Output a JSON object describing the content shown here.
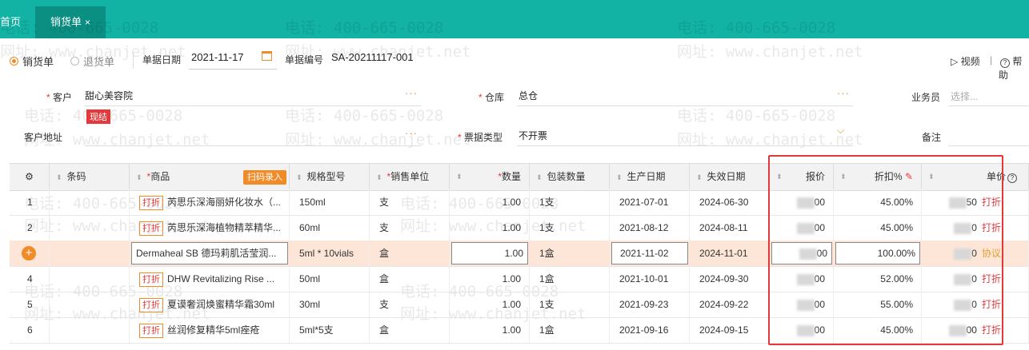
{
  "tabs": [
    {
      "label": "首页"
    },
    {
      "label": "销货单"
    }
  ],
  "close_glyph": "×",
  "doc_type": {
    "options": [
      "销货单",
      "退货单"
    ],
    "selected": "销货单"
  },
  "header": {
    "date_label": "单据日期",
    "date_value": "2021-11-17",
    "no_label": "单据编号",
    "no_value": "SA-20211117-001",
    "video_label": "视频",
    "help_label": "帮助",
    "divider": "|"
  },
  "form": {
    "customer_label": "客户",
    "customer_value": "甜心美容院",
    "customer_badge": "现结",
    "address_label": "客户地址",
    "warehouse_label": "仓库",
    "warehouse_value": "总仓",
    "invoice_label": "票据类型",
    "invoice_value": "不开票",
    "salesman_label": "业务员",
    "salesman_placeholder": "选择...",
    "remark_label": "备注",
    "more": "···",
    "required_mark": "*"
  },
  "watermark": {
    "phone": "电话: 400-665-0028",
    "site": "网址: www.chanjet.net"
  },
  "table": {
    "columns": {
      "barcode": "条码",
      "product": "商品",
      "scan": "扫码录入",
      "spec": "规格型号",
      "unit": "销售单位",
      "qty": "数量",
      "pack": "包装数量",
      "mfg": "生产日期",
      "exp": "失效日期",
      "price": "报价",
      "discount": "折扣%",
      "unit_price": "单价"
    },
    "rows": [
      {
        "no": "1",
        "tag": "打折",
        "product": "芮思乐深海丽妍化妆水（...",
        "spec": "150ml",
        "unit": "支",
        "qty": "1.00",
        "pack": "1支",
        "mfg": "2021-07-01",
        "exp": "2024-06-30",
        "price": "00",
        "discount": "45.00%",
        "unit_price": "50",
        "action": "打折"
      },
      {
        "no": "2",
        "tag": "打折",
        "product": "芮思乐深海植物精萃精华...",
        "spec": "60ml",
        "unit": "支",
        "qty": "1.00",
        "pack": "1支",
        "mfg": "2021-08-12",
        "exp": "2024-08-11",
        "price": "00",
        "discount": "45.00%",
        "unit_price": "0",
        "action": "打折"
      },
      {
        "no": "+",
        "tag": "",
        "product": "Dermaheal SB 德玛莉肌活莹润...",
        "spec": "5ml * 10vials",
        "unit": "盒",
        "qty": "1.00",
        "pack": "1盒",
        "mfg": "2021-11-02",
        "exp": "2024-11-01",
        "price": "00",
        "discount": "100.00%",
        "unit_price": "0",
        "action": "协议"
      },
      {
        "no": "4",
        "tag": "打折",
        "product": "DHW Revitalizing Rise ...",
        "spec": "50ml",
        "unit": "盒",
        "qty": "1.00",
        "pack": "1盒",
        "mfg": "2021-10-01",
        "exp": "2024-09-30",
        "price": "00",
        "discount": "52.00%",
        "unit_price": "0",
        "action": "打折"
      },
      {
        "no": "5",
        "tag": "打折",
        "product": "夏谟奢润焕蜜精华霜30ml",
        "spec": "30ml",
        "unit": "支",
        "qty": "1.00",
        "pack": "1支",
        "mfg": "2021-09-23",
        "exp": "2024-09-22",
        "price": "00",
        "discount": "55.00%",
        "unit_price": "0",
        "action": "打折"
      },
      {
        "no": "6",
        "tag": "打折",
        "product": "丝润修复精华5ml痤疮",
        "spec": "5ml*5支",
        "unit": "盒",
        "qty": "1.00",
        "pack": "1盒",
        "mfg": "2021-09-16",
        "exp": "2024-09-15",
        "price": "00",
        "discount": "45.00%",
        "unit_price": "00",
        "action": "打折"
      }
    ]
  }
}
